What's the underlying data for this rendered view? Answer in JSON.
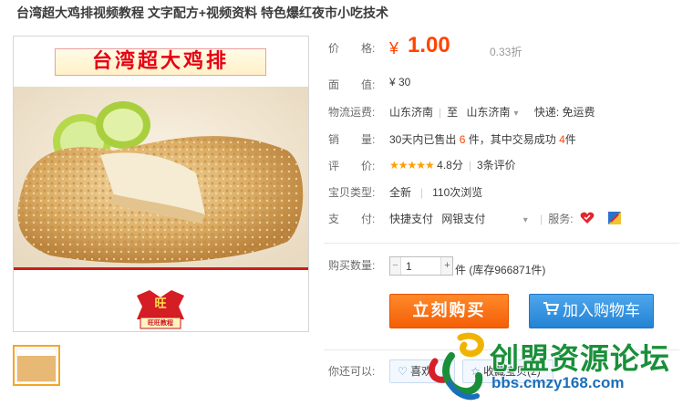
{
  "title": "台湾超大鸡排视频教程 文字配方+视频资料 特色爆红夜市小吃技术",
  "image": {
    "banner_text": "台湾超大鸡排",
    "seal_top": "旺",
    "seal_bottom": "旺旺教程"
  },
  "price": {
    "label": "价　　格:",
    "currency": "¥",
    "value": "1.00",
    "discount": "0.33折"
  },
  "face_value": {
    "label": "面　　值:",
    "value": "¥ 30"
  },
  "shipping": {
    "label": "物流运费:",
    "from": "山东济南",
    "to_word": "至",
    "to": "山东济南",
    "express": "快递: 免运费"
  },
  "sales": {
    "label": "销　　量:",
    "prefix": "30天内已售出",
    "count": "6",
    "unit": "件，其中交易成功",
    "success": "4",
    "suffix": "件"
  },
  "rating": {
    "label": "评　　价:",
    "stars": "★★★★★",
    "score": "4.8分",
    "reviews": "3条评价"
  },
  "item_type": {
    "label": "宝贝类型:",
    "condition": "全新",
    "views": "110次浏览"
  },
  "payment": {
    "label": "支　　付:",
    "method1": "快捷支付",
    "method2": "网银支付",
    "service_label": "服务:"
  },
  "quantity": {
    "label": "购买数量:",
    "value": "1",
    "minus": "−",
    "plus": "+",
    "stock": "件 (库存966871件)"
  },
  "buttons": {
    "buy": "立刻购买",
    "cart": "加入购物车"
  },
  "extra": {
    "label": "你还可以:",
    "like": "喜欢",
    "favorite": "收藏宝贝(2)"
  },
  "watermark": {
    "name": "创盟资源论坛",
    "url": "bbs.cmzy168.com"
  },
  "colors": {
    "price": "#ff4400",
    "buy_button": "#f45e06",
    "cart_button": "#2383d4",
    "stars": "#ff9e00"
  }
}
